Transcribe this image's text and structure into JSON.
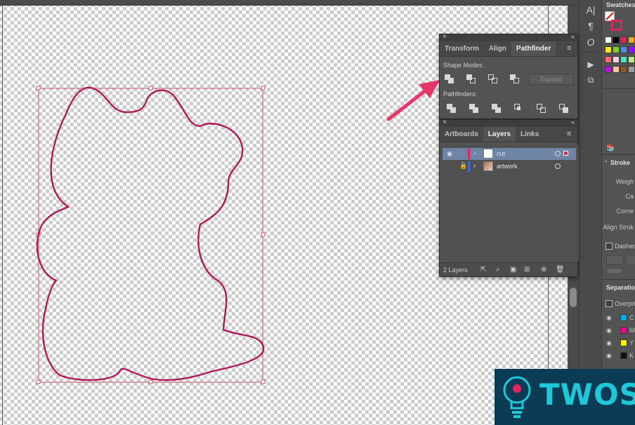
{
  "pathfinder_panel": {
    "tabs": [
      "Transform",
      "Align",
      "Pathfinder"
    ],
    "active_tab": "Pathfinder",
    "shape_modes_label": "Shape Modes:",
    "expand_label": "Expand",
    "pathfinders_label": "Pathfinders:"
  },
  "layers_panel": {
    "tabs": [
      "Artboards",
      "Layers",
      "Links"
    ],
    "active_tab": "Layers",
    "layers": [
      {
        "name": "cut",
        "color": "#e0245e",
        "selected": true,
        "locked": false
      },
      {
        "name": "artwork",
        "color": "#3b6fd6",
        "selected": false,
        "locked": true
      }
    ],
    "count_label": "2 Layers"
  },
  "swatches_panel": {
    "title": "Swatches",
    "colors": [
      "#ffffff",
      "#000000",
      "#e0245e",
      "#f5a623",
      "#f8e71c",
      "#7ed321",
      "#4a90e2",
      "#9013fe",
      "#ff6b6b",
      "#ffd1dc",
      "#50e3c2",
      "#b8e986",
      "#bd10e0",
      "#f7c59f",
      "#8b572a",
      "#9b9b9b"
    ]
  },
  "stroke_panel": {
    "title": "Stroke",
    "weight_label": "Weigh",
    "cap_label": "Ca",
    "corner_label": "Corne",
    "align_label": "Align Strok",
    "dashed_label": "Dashed",
    "dash_label": "dash"
  },
  "separations_panel": {
    "title": "Separatio",
    "overprint_label": "Overpri",
    "inks": [
      {
        "code": "C",
        "color": "#00aeef"
      },
      {
        "code": "M",
        "color": "#ec008c"
      },
      {
        "code": "Y",
        "color": "#fff200"
      },
      {
        "code": "K",
        "color": "#111111"
      }
    ]
  },
  "watermark": {
    "text": "TWOS"
  },
  "colors": {
    "cut_path": "#b0195a",
    "bounding_box": "#c45a6a",
    "arrow": "#e8356a"
  }
}
